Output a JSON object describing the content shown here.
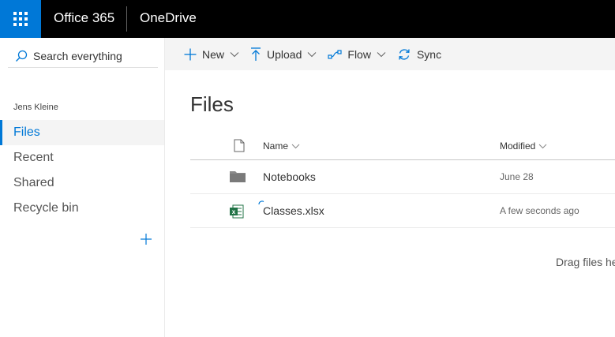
{
  "suite": {
    "brand": "Office 365",
    "app": "OneDrive",
    "waffle_icon": "app-launcher-icon",
    "accent": "#0078d7"
  },
  "nav": {
    "search_placeholder": "Search everything",
    "user_name": "Jens Kleine",
    "items": [
      {
        "label": "Files",
        "active": true
      },
      {
        "label": "Recent",
        "active": false
      },
      {
        "label": "Shared",
        "active": false
      },
      {
        "label": "Recycle bin",
        "active": false
      }
    ],
    "add_icon": "plus-icon"
  },
  "commands": {
    "new": "New",
    "upload": "Upload",
    "flow": "Flow",
    "sync": "Sync"
  },
  "main": {
    "title": "Files",
    "columns": {
      "name": "Name",
      "modified": "Modified"
    },
    "rows": [
      {
        "name": "Notebooks",
        "modified": "June 28",
        "icon": "folder-icon"
      },
      {
        "name": "Classes.xlsx",
        "modified": "A few seconds ago",
        "icon": "excel-file-icon"
      }
    ],
    "drag_hint": "Drag files he"
  }
}
